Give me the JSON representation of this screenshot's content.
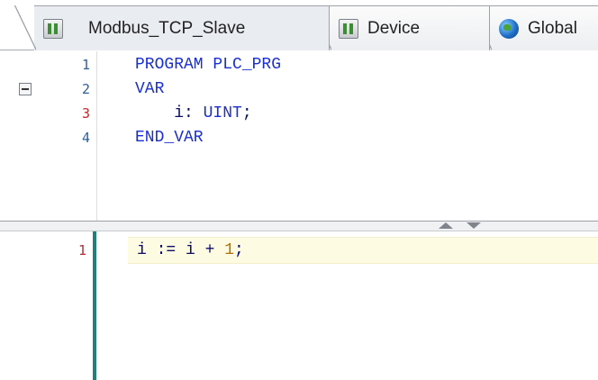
{
  "tabs": [
    {
      "label": "Modbus_TCP_Slave",
      "icon": "object-icon",
      "active": true
    },
    {
      "label": "Device",
      "icon": "object-icon",
      "active": false
    },
    {
      "label": "Global",
      "icon": "globe-icon",
      "active": false
    }
  ],
  "declaration": {
    "lines": [
      {
        "number": "1",
        "keyword": "PROGRAM",
        "rest": " PLC_PRG"
      },
      {
        "number": "2",
        "keyword": "VAR",
        "rest": ""
      },
      {
        "number": "3",
        "indent": "    ",
        "ident": "i: ",
        "keyword": "UINT",
        "rest": ";"
      },
      {
        "number": "4",
        "keyword": "END_VAR",
        "rest": ""
      }
    ]
  },
  "implementation": {
    "line_number": "1",
    "code_prefix": "i := i + ",
    "code_number": "1",
    "code_suffix": ";"
  },
  "colors": {
    "keyword": "#1b2fd1",
    "identifier": "#0b0b6a",
    "number_literal": "#b06f00",
    "current_line_bg": "#fdfbe2",
    "implementation_bar": "#21807a"
  }
}
